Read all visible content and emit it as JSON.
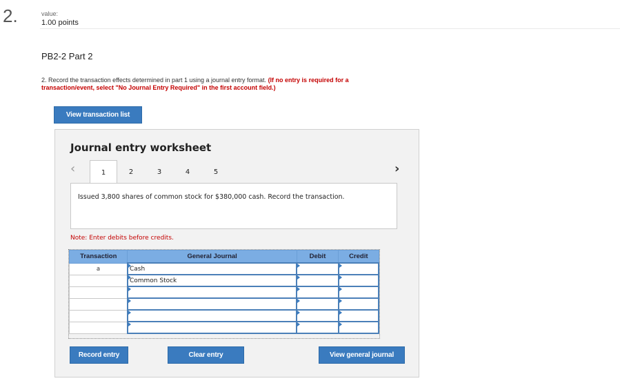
{
  "question": {
    "number": "2.",
    "value_label": "value:",
    "points": "1.00 points",
    "part_title": "PB2-2 Part 2",
    "instruction_num": "2.",
    "instruction_text": "Record the transaction effects determined in part 1 using a journal entry format.",
    "instruction_red": "(If no entry is required for a transaction/event, select \"No Journal Entry Required\" in the first account field.)"
  },
  "buttons": {
    "view_transaction_list": "View transaction list",
    "record_entry": "Record entry",
    "clear_entry": "Clear entry",
    "view_general_journal": "View general journal"
  },
  "worksheet": {
    "title": "Journal entry worksheet",
    "tabs": [
      "1",
      "2",
      "3",
      "4",
      "5"
    ],
    "active_tab": "1",
    "description": "Issued 3,800 shares of common stock for $380,000 cash. Record the transaction.",
    "note": "Note: Enter debits before credits.",
    "columns": [
      "Transaction",
      "General Journal",
      "Debit",
      "Credit"
    ],
    "rows": [
      {
        "transaction": "a",
        "account": "Cash",
        "debit": "",
        "credit": ""
      },
      {
        "transaction": "",
        "account": "Common Stock",
        "debit": "",
        "credit": ""
      },
      {
        "transaction": "",
        "account": "",
        "debit": "",
        "credit": ""
      },
      {
        "transaction": "",
        "account": "",
        "debit": "",
        "credit": ""
      },
      {
        "transaction": "",
        "account": "",
        "debit": "",
        "credit": ""
      },
      {
        "transaction": "",
        "account": "",
        "debit": "",
        "credit": ""
      }
    ]
  },
  "icons": {
    "prev": "chevron-left-icon",
    "next": "chevron-right-icon"
  },
  "colors": {
    "button_blue": "#3a7bbf",
    "header_blue": "#7bade3",
    "instruction_red": "#c40000"
  }
}
